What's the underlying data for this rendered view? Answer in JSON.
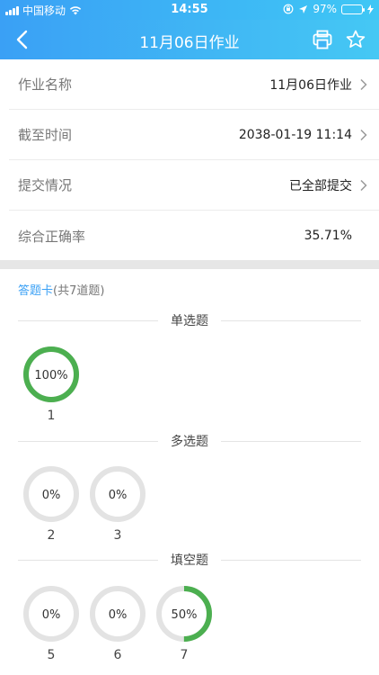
{
  "status": {
    "carrier": "中国移动",
    "time": "14:55",
    "battery": "97%",
    "battery_level": 0.97
  },
  "nav": {
    "title": "11月06日作业"
  },
  "info": {
    "rows": [
      {
        "label": "作业名称",
        "value": "11月06日作业"
      },
      {
        "label": "截至时间",
        "value": "2038-01-19 11:14"
      },
      {
        "label": "提交情况",
        "value": "已全部提交"
      },
      {
        "label": "综合正确率",
        "value": "35.71%"
      }
    ]
  },
  "card": {
    "title": "答题卡",
    "count": "(共7道题)"
  },
  "groups": [
    {
      "label": "单选题",
      "questions": [
        {
          "num": "1",
          "percent_text": "100%",
          "percent": 100
        }
      ]
    },
    {
      "label": "多选题",
      "questions": [
        {
          "num": "2",
          "percent_text": "0%",
          "percent": 0
        },
        {
          "num": "3",
          "percent_text": "0%",
          "percent": 0
        }
      ]
    },
    {
      "label": "填空题",
      "questions": [
        {
          "num": "5",
          "percent_text": "0%",
          "percent": 0
        },
        {
          "num": "6",
          "percent_text": "0%",
          "percent": 0
        },
        {
          "num": "7",
          "percent_text": "50%",
          "percent": 50
        }
      ]
    }
  ],
  "colors": {
    "accent": "#3aa0f5",
    "progress": "#4caf50",
    "track": "#e3e3e3"
  }
}
